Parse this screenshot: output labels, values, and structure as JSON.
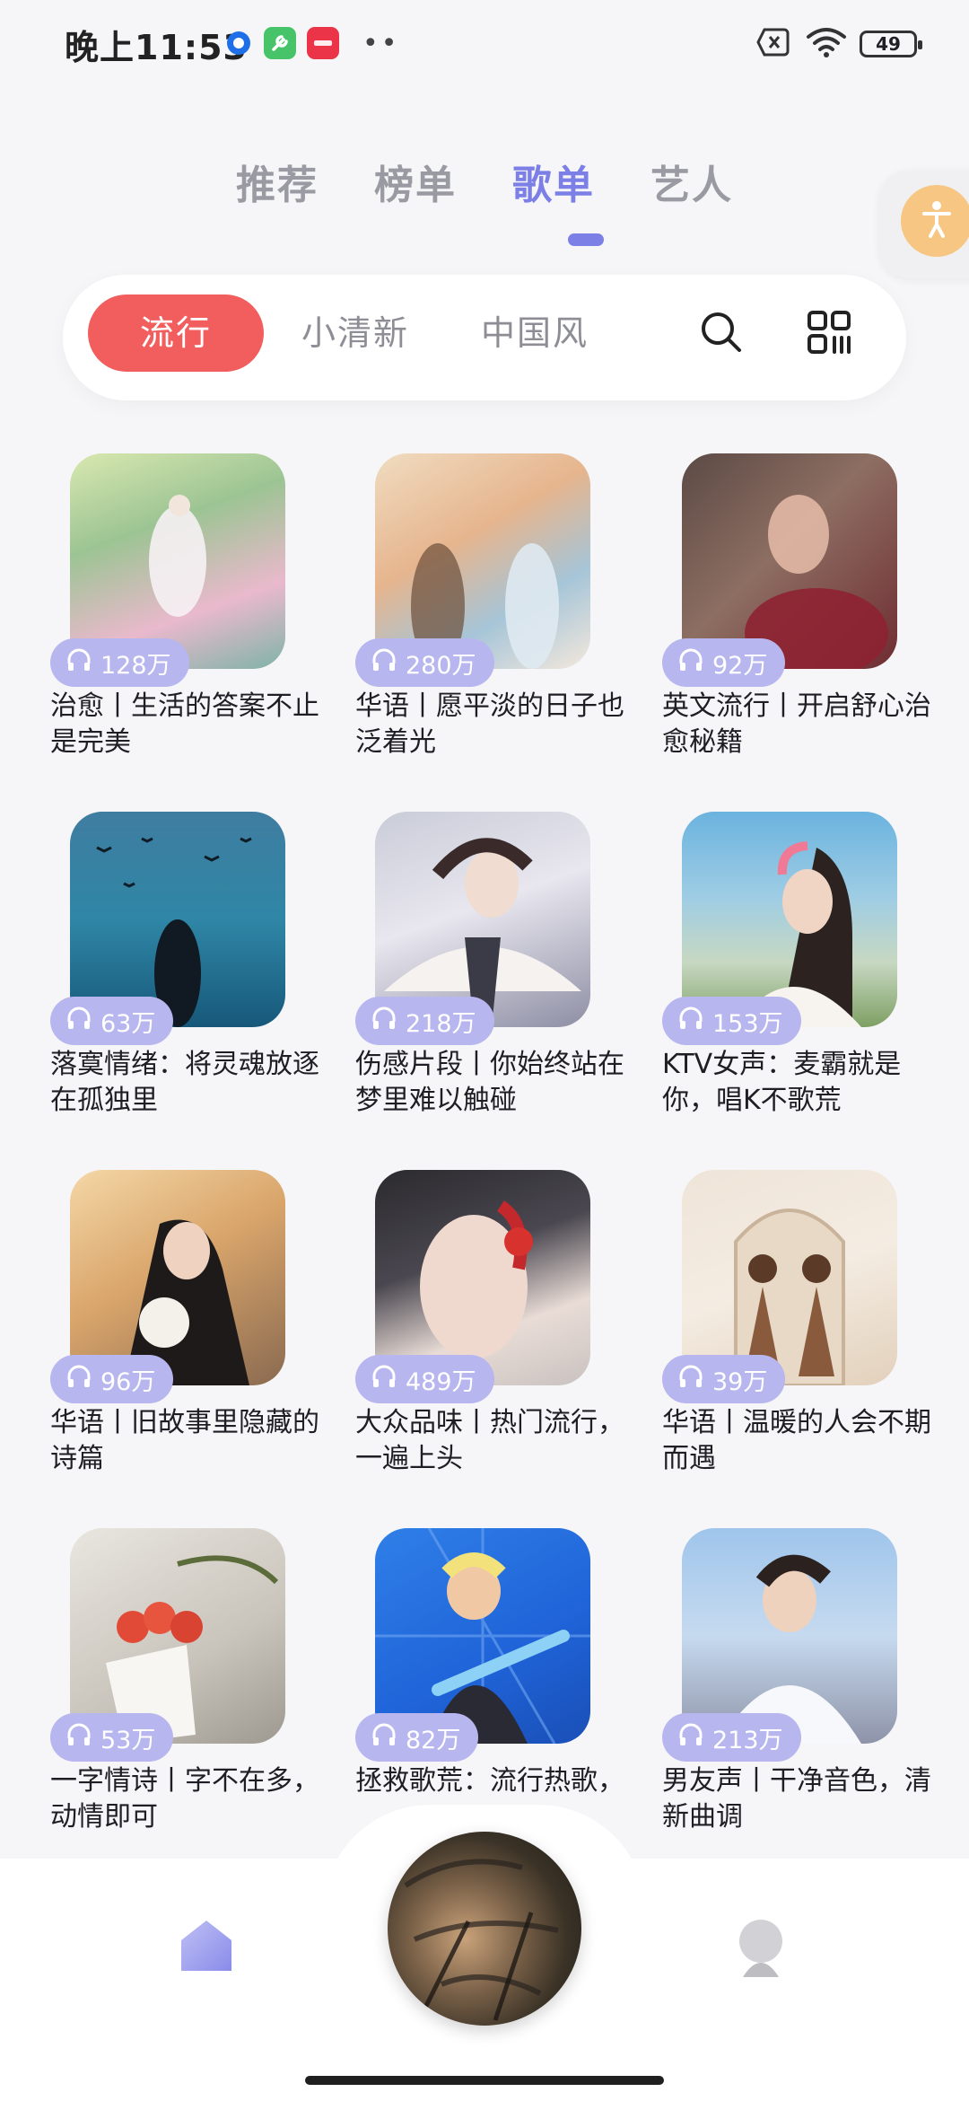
{
  "status_bar": {
    "time": "晚上11:53",
    "battery": "49",
    "app_icons": [
      "browser-icon",
      "wrench-app-icon",
      "xiaohongshu-icon"
    ]
  },
  "top_tabs": [
    {
      "label": "推荐",
      "active": false
    },
    {
      "label": "榜单",
      "active": false
    },
    {
      "label": "歌单",
      "active": true
    },
    {
      "label": "艺人",
      "active": false
    }
  ],
  "categories": [
    {
      "label": "流行",
      "active": true
    },
    {
      "label": "小清新",
      "active": false
    },
    {
      "label": "中国风",
      "active": false
    }
  ],
  "playlists": [
    {
      "plays": "128万",
      "title": "治愈丨生活的答案不止是完美"
    },
    {
      "plays": "280万",
      "title": "华语丨愿平淡的日子也泛着光"
    },
    {
      "plays": "92万",
      "title": "英文流行丨开启舒心治愈秘籍"
    },
    {
      "plays": "63万",
      "title": "落寞情绪：将灵魂放逐在孤独里"
    },
    {
      "plays": "218万",
      "title": "伤感片段丨你始终站在梦里难以触碰"
    },
    {
      "plays": "153万",
      "title": "KTV女声：麦霸就是你，唱K不歌荒"
    },
    {
      "plays": "96万",
      "title": "华语丨旧故事里隐藏的诗篇"
    },
    {
      "plays": "489万",
      "title": "大众品味丨热门流行，一遍上头"
    },
    {
      "plays": "39万",
      "title": "华语丨温暖的人会不期而遇"
    },
    {
      "plays": "53万",
      "title": "一字情诗丨字不在多，动情即可"
    },
    {
      "plays": "82万",
      "title": "拯救歌荒：流行热歌，"
    },
    {
      "plays": "213万",
      "title": "男友声丨干净音色，清新曲调"
    }
  ],
  "colors": {
    "accent": "#7b7fe6",
    "category_active": "#f25e5e",
    "play_badge": "#b8b6ee",
    "accessibility": "#f7c682"
  }
}
